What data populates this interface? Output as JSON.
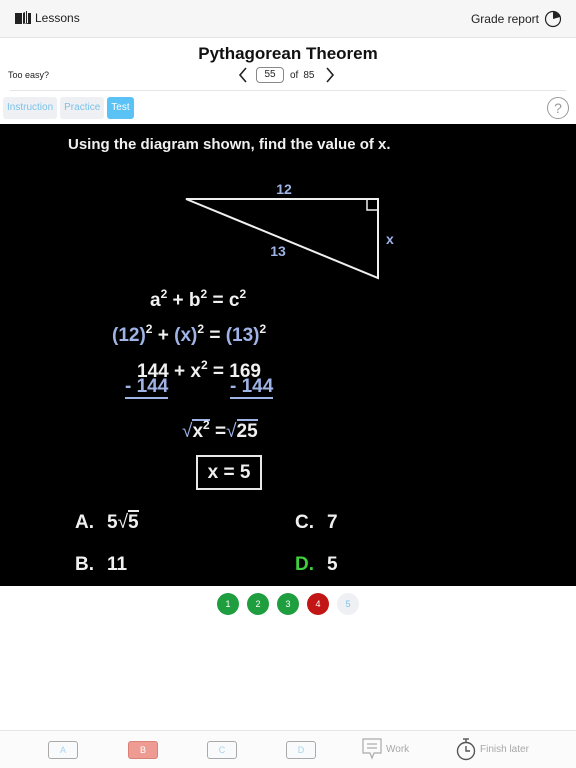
{
  "topbar": {
    "lessons_label": "Lessons",
    "grade_report_label": "Grade report",
    "icons": {
      "lessons": "book-icon",
      "grade": "pie-progress-icon"
    }
  },
  "header": {
    "title": "Pythagorean Theorem",
    "too_easy_label": "Too easy?",
    "pager": {
      "current": "55",
      "of_label": "of",
      "total": "85"
    }
  },
  "tabs": [
    {
      "label": "Instruction",
      "active": false
    },
    {
      "label": "Practice",
      "active": false
    },
    {
      "label": "Test",
      "active": true
    }
  ],
  "help_label": "?",
  "problem": {
    "question": "Using the diagram shown, find the value of x.",
    "diagram": {
      "side_top": "12",
      "hypotenuse": "13",
      "side_right": "x"
    },
    "steps": {
      "eq1": {
        "a": "a",
        "b": "b",
        "c": "c",
        "exp": "2"
      },
      "eq2": {
        "left1": "(12)",
        "left2": "(x)",
        "right": "(13)",
        "exp": "2"
      },
      "eq3": {
        "left": "144",
        "var": "x",
        "right": "169",
        "exp": "2"
      },
      "subtract_left": "- 144",
      "subtract_right": "- 144",
      "eq4": {
        "left": "x",
        "right": "25",
        "exp": "2"
      },
      "answer": "x = 5"
    },
    "choices": [
      {
        "letter": "A.",
        "value": "5",
        "radical": "5",
        "correct": false
      },
      {
        "letter": "B.",
        "value": "11",
        "correct": false
      },
      {
        "letter": "C.",
        "value": "7",
        "correct": false
      },
      {
        "letter": "D.",
        "value": "5",
        "correct": true
      }
    ],
    "colors": {
      "accent_blue": "#9fb3e6",
      "correct_green": "#3fcf3f"
    }
  },
  "progress_dots": [
    {
      "label": "1",
      "status": "correct"
    },
    {
      "label": "2",
      "status": "correct"
    },
    {
      "label": "3",
      "status": "correct"
    },
    {
      "label": "4",
      "status": "incorrect"
    },
    {
      "label": "5",
      "status": "pending"
    }
  ],
  "bottombar": {
    "options": [
      "A",
      "B",
      "C",
      "D"
    ],
    "selected_wrong": "B",
    "work_label": "Work",
    "finish_label": "Finish later"
  }
}
